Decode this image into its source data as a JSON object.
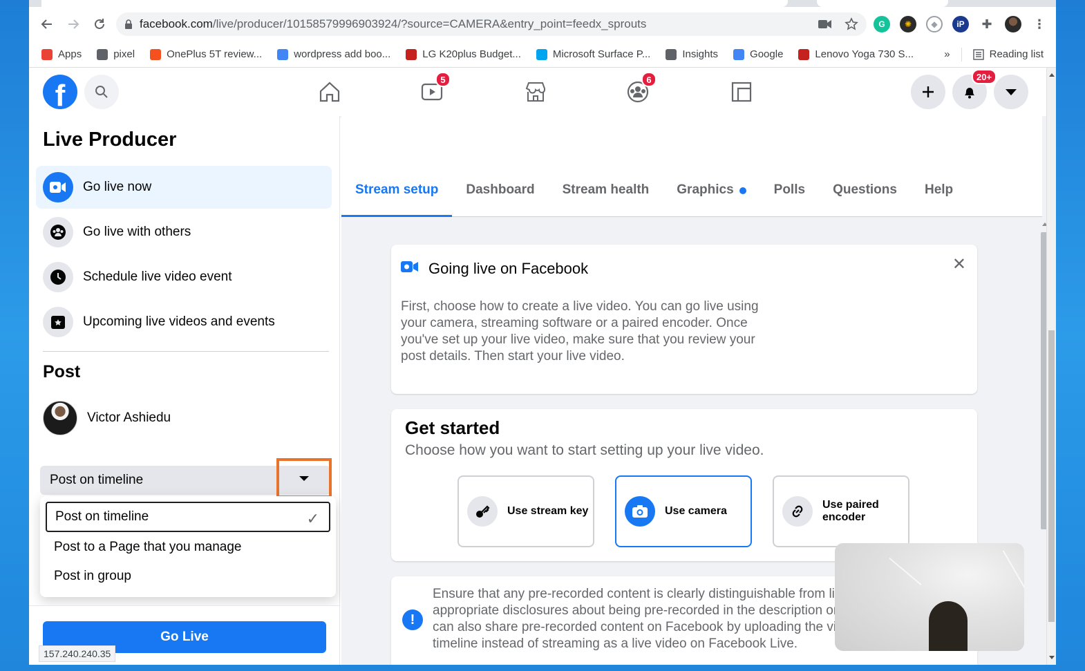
{
  "browser": {
    "url_host": "facebook.com",
    "url_path": "/live/producer/10158579996903924/?source=CAMERA&entry_point=feedx_sprouts",
    "bookmarks": [
      {
        "label": "Apps",
        "color": "#ea4335"
      },
      {
        "label": "pixel",
        "color": "#5f6368"
      },
      {
        "label": "OnePlus 5T review...",
        "color": "#f4511e"
      },
      {
        "label": "wordpress add boo...",
        "color": "#4285f4"
      },
      {
        "label": "LG K20plus Budget...",
        "color": "#c5221f"
      },
      {
        "label": "Microsoft Surface P...",
        "color": "#00a4ef"
      },
      {
        "label": "Insights",
        "color": "#5f6368"
      },
      {
        "label": "Google",
        "color": "#4285f4"
      },
      {
        "label": "Lenovo Yoga 730 S...",
        "color": "#c5221f"
      }
    ],
    "more_bookmarks": "»",
    "reading_list": "Reading list",
    "status_ip": "157.240.240.35"
  },
  "fb": {
    "logo": "f",
    "watch_badge": "5",
    "groups_badge": "6",
    "notif_badge": "20+"
  },
  "left": {
    "title": "Live Producer",
    "items": [
      {
        "label": "Go live now",
        "icon": "video-camera-icon"
      },
      {
        "label": "Go live with others",
        "icon": "group-icon"
      },
      {
        "label": "Schedule live video event",
        "icon": "clock-icon"
      },
      {
        "label": "Upcoming live videos and events",
        "icon": "calendar-star-icon"
      }
    ],
    "post_heading": "Post",
    "user_name": "Victor Ashiedu",
    "select_value": "Post on timeline",
    "dropdown": [
      "Post on timeline",
      "Post to a Page that you manage",
      "Post in group"
    ],
    "go_live": "Go Live"
  },
  "tabs": [
    "Stream setup",
    "Dashboard",
    "Stream health",
    "Graphics",
    "Polls",
    "Questions",
    "Help"
  ],
  "card1": {
    "title": "Going live on Facebook",
    "body": "First, choose how to create a live video. You can go live using your camera, streaming software or a paired encoder. Once you've set up your live video, make sure that you review your post details. Then start your live video."
  },
  "card2": {
    "title": "Get started",
    "subtitle": "Choose how you want to start setting up your live video.",
    "options": [
      "Use stream key",
      "Use camera",
      "Use paired encoder"
    ]
  },
  "card3": {
    "lines": [
      "Ensure that any pre-recorded content is clearly distinguishable from liv",
      "appropriate disclosures about being pre-recorded in the description or",
      "can also share pre-recorded content on Facebook by uploading the vid",
      "timeline instead of streaming as a live video on Facebook Live."
    ]
  }
}
